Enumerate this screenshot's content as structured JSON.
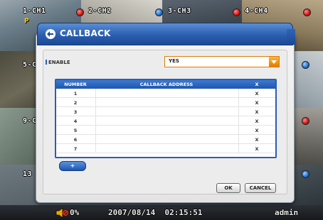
{
  "cameras": [
    {
      "label": "1-CH1",
      "indicator": "red"
    },
    {
      "label": "2-CH2",
      "indicator": "blue"
    },
    {
      "label": "3-CH3",
      "indicator": "red"
    },
    {
      "label": "4-CH4",
      "indicator": "red"
    },
    {
      "label": "5-C",
      "indicator": "blue"
    },
    {
      "label": "9-C",
      "indicator": "red"
    },
    {
      "label": "13",
      "indicator": "blue"
    }
  ],
  "camera_badge": "P",
  "dialog": {
    "title": "CALLBACK",
    "enable_label": "ENABLE",
    "enable_value": "YES",
    "table": {
      "headers": [
        "NUMBER",
        "CALLBACK ADDRESS",
        "X"
      ],
      "rows": [
        {
          "number": "1",
          "address": "",
          "delete": "X"
        },
        {
          "number": "2",
          "address": "",
          "delete": "X"
        },
        {
          "number": "3",
          "address": "",
          "delete": "X"
        },
        {
          "number": "4",
          "address": "",
          "delete": "X"
        },
        {
          "number": "5",
          "address": "",
          "delete": "X"
        },
        {
          "number": "6",
          "address": "",
          "delete": "X"
        },
        {
          "number": "7",
          "address": "",
          "delete": "X"
        }
      ]
    },
    "add_label": "+",
    "ok_label": "OK",
    "cancel_label": "CANCEL"
  },
  "status": {
    "volume": "0%",
    "datetime": "2007/08/14  02:15:51",
    "user": "admin"
  },
  "colors": {
    "title_bar": "#2a5eb0",
    "accent": "#e07b00",
    "recording": "#d31414"
  }
}
